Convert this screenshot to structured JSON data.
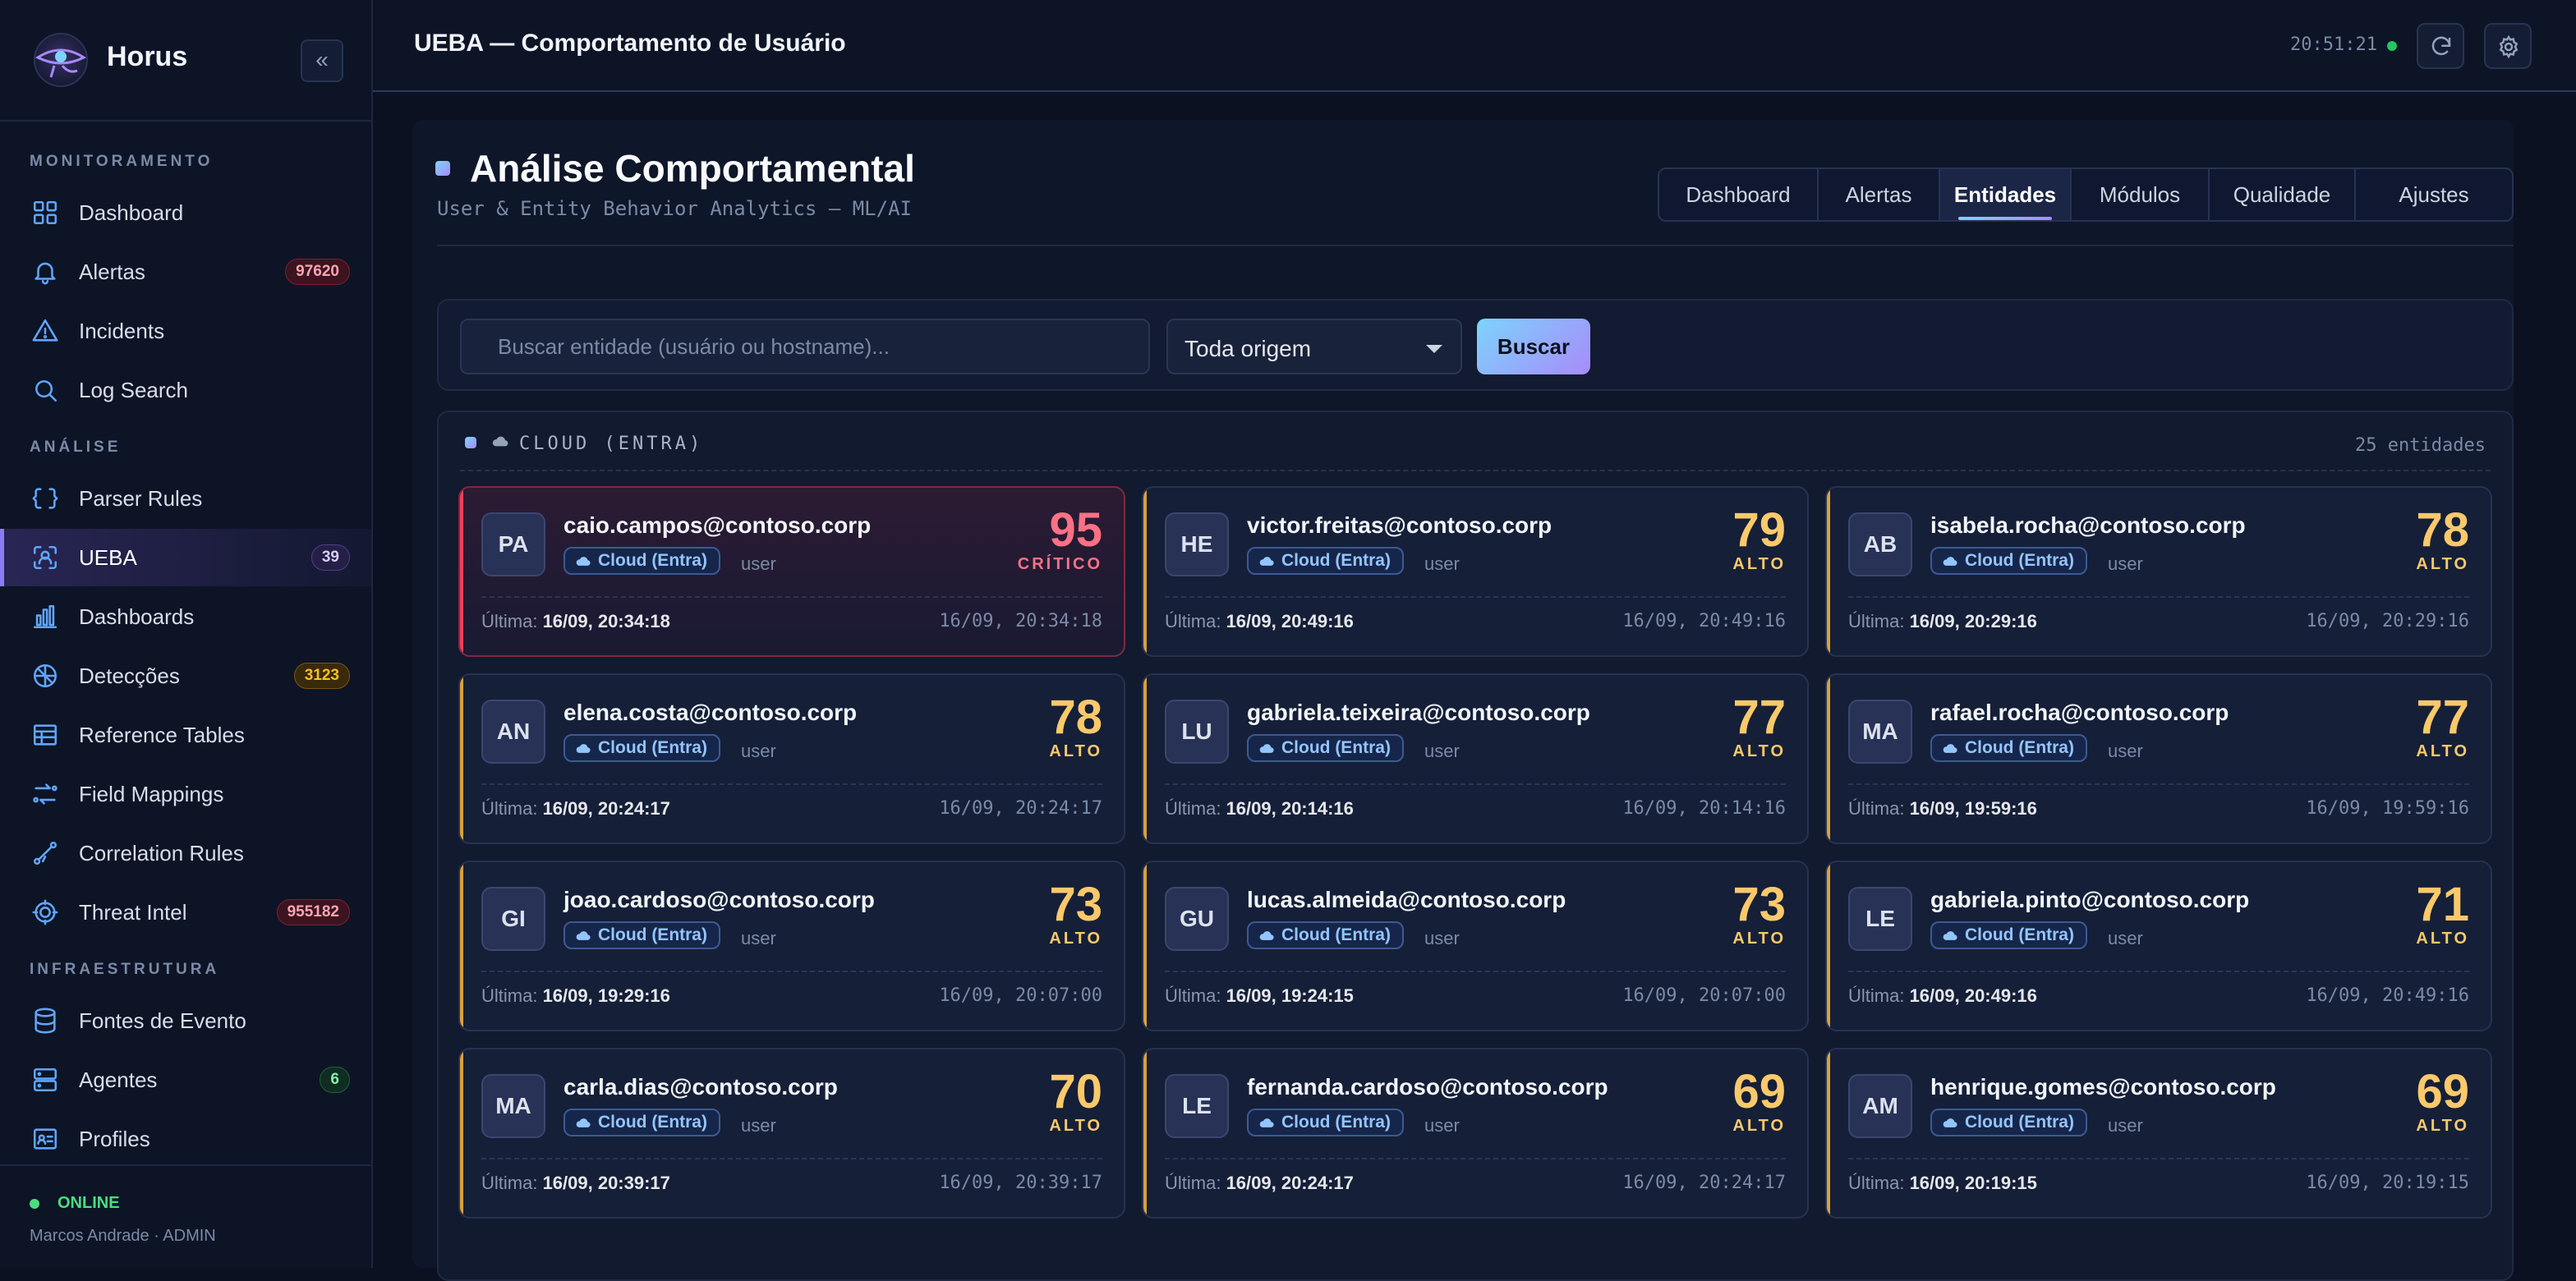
{
  "brand": {
    "name": "Horus"
  },
  "sidebar": {
    "sections": [
      {
        "title": "MONITORAMENTO",
        "items": [
          {
            "label": "Dashboard",
            "icon": "grid-icon"
          },
          {
            "label": "Alertas",
            "icon": "bell-icon",
            "badge": "97620",
            "badge_style": "red"
          },
          {
            "label": "Incidents",
            "icon": "warning-icon"
          },
          {
            "label": "Log Search",
            "icon": "search-icon"
          }
        ]
      },
      {
        "title": "ANÁLISE",
        "items": [
          {
            "label": "Parser Rules",
            "icon": "code-icon"
          },
          {
            "label": "UEBA",
            "icon": "scan-user-icon",
            "badge": "39",
            "badge_style": "purple",
            "active": true
          },
          {
            "label": "Dashboards",
            "icon": "bar-chart-icon"
          },
          {
            "label": "Detecções",
            "icon": "radar-icon",
            "badge": "3123",
            "badge_style": "amber"
          },
          {
            "label": "Reference Tables",
            "icon": "table-icon"
          },
          {
            "label": "Field Mappings",
            "icon": "mapping-icon"
          },
          {
            "label": "Correlation Rules",
            "icon": "correlation-icon"
          },
          {
            "label": "Threat Intel",
            "icon": "gear-target-icon",
            "badge": "955182",
            "badge_style": "red"
          }
        ]
      },
      {
        "title": "INFRAESTRUTURA",
        "items": [
          {
            "label": "Fontes de Evento",
            "icon": "database-icon"
          },
          {
            "label": "Agentes",
            "icon": "server-icon",
            "badge": "6",
            "badge_style": "green"
          },
          {
            "label": "Profiles",
            "icon": "id-card-icon"
          }
        ]
      }
    ],
    "footer": {
      "status": "ONLINE",
      "user": "Marcos Andrade · ADMIN"
    }
  },
  "topbar": {
    "title": "UEBA — Comportamento de Usuário",
    "clock": "20:51:21"
  },
  "page": {
    "title": "Análise Comportamental",
    "subtitle": "User & Entity Behavior Analytics — ML/AI",
    "tabs": [
      {
        "label": "Dashboard"
      },
      {
        "label": "Alertas"
      },
      {
        "label": "Entidades",
        "active": true
      },
      {
        "label": "Módulos"
      },
      {
        "label": "Qualidade"
      },
      {
        "label": "Ajustes"
      }
    ]
  },
  "search": {
    "placeholder": "Buscar entidade (usuário ou hostname)...",
    "value": "",
    "origin": "Toda origem",
    "button": "Buscar"
  },
  "group": {
    "title": "CLOUD (ENTRA)",
    "count": "25 entidades",
    "last_label": "Última:",
    "source_label": "Cloud (Entra)",
    "colors": {
      "alto": "#f9c96a",
      "critico": "#fb7185"
    },
    "entities": [
      {
        "initials": "PA",
        "email": "caio.campos@contoso.corp",
        "type": "user",
        "score": "95",
        "level": "CRÍTICO",
        "severity": "critico",
        "last": "16/09, 20:34:18",
        "time": "16/09, 20:34:18"
      },
      {
        "initials": "HE",
        "email": "victor.freitas@contoso.corp",
        "type": "user",
        "score": "79",
        "level": "ALTO",
        "severity": "alto",
        "last": "16/09, 20:49:16",
        "time": "16/09, 20:49:16"
      },
      {
        "initials": "AB",
        "email": "isabela.rocha@contoso.corp",
        "type": "user",
        "score": "78",
        "level": "ALTO",
        "severity": "alto",
        "last": "16/09, 20:29:16",
        "time": "16/09, 20:29:16"
      },
      {
        "initials": "AN",
        "email": "elena.costa@contoso.corp",
        "type": "user",
        "score": "78",
        "level": "ALTO",
        "severity": "alto",
        "last": "16/09, 20:24:17",
        "time": "16/09, 20:24:17"
      },
      {
        "initials": "LU",
        "email": "gabriela.teixeira@contoso.corp",
        "type": "user",
        "score": "77",
        "level": "ALTO",
        "severity": "alto",
        "last": "16/09, 20:14:16",
        "time": "16/09, 20:14:16"
      },
      {
        "initials": "MA",
        "email": "rafael.rocha@contoso.corp",
        "type": "user",
        "score": "77",
        "level": "ALTO",
        "severity": "alto",
        "last": "16/09, 19:59:16",
        "time": "16/09, 19:59:16"
      },
      {
        "initials": "GI",
        "email": "joao.cardoso@contoso.corp",
        "type": "user",
        "score": "73",
        "level": "ALTO",
        "severity": "alto",
        "last": "16/09, 19:29:16",
        "time": "16/09, 20:07:00"
      },
      {
        "initials": "GU",
        "email": "lucas.almeida@contoso.corp",
        "type": "user",
        "score": "73",
        "level": "ALTO",
        "severity": "alto",
        "last": "16/09, 19:24:15",
        "time": "16/09, 20:07:00"
      },
      {
        "initials": "LE",
        "email": "gabriela.pinto@contoso.corp",
        "type": "user",
        "score": "71",
        "level": "ALTO",
        "severity": "alto",
        "last": "16/09, 20:49:16",
        "time": "16/09, 20:49:16"
      },
      {
        "initials": "MA",
        "email": "carla.dias@contoso.corp",
        "type": "user",
        "score": "70",
        "level": "ALTO",
        "severity": "alto",
        "last": "16/09, 20:39:17",
        "time": "16/09, 20:39:17"
      },
      {
        "initials": "LE",
        "email": "fernanda.cardoso@contoso.corp",
        "type": "user",
        "score": "69",
        "level": "ALTO",
        "severity": "alto",
        "last": "16/09, 20:24:17",
        "time": "16/09, 20:24:17"
      },
      {
        "initials": "AM",
        "email": "henrique.gomes@contoso.corp",
        "type": "user",
        "score": "69",
        "level": "ALTO",
        "severity": "alto",
        "last": "16/09, 20:19:15",
        "time": "16/09, 20:19:15"
      }
    ]
  }
}
